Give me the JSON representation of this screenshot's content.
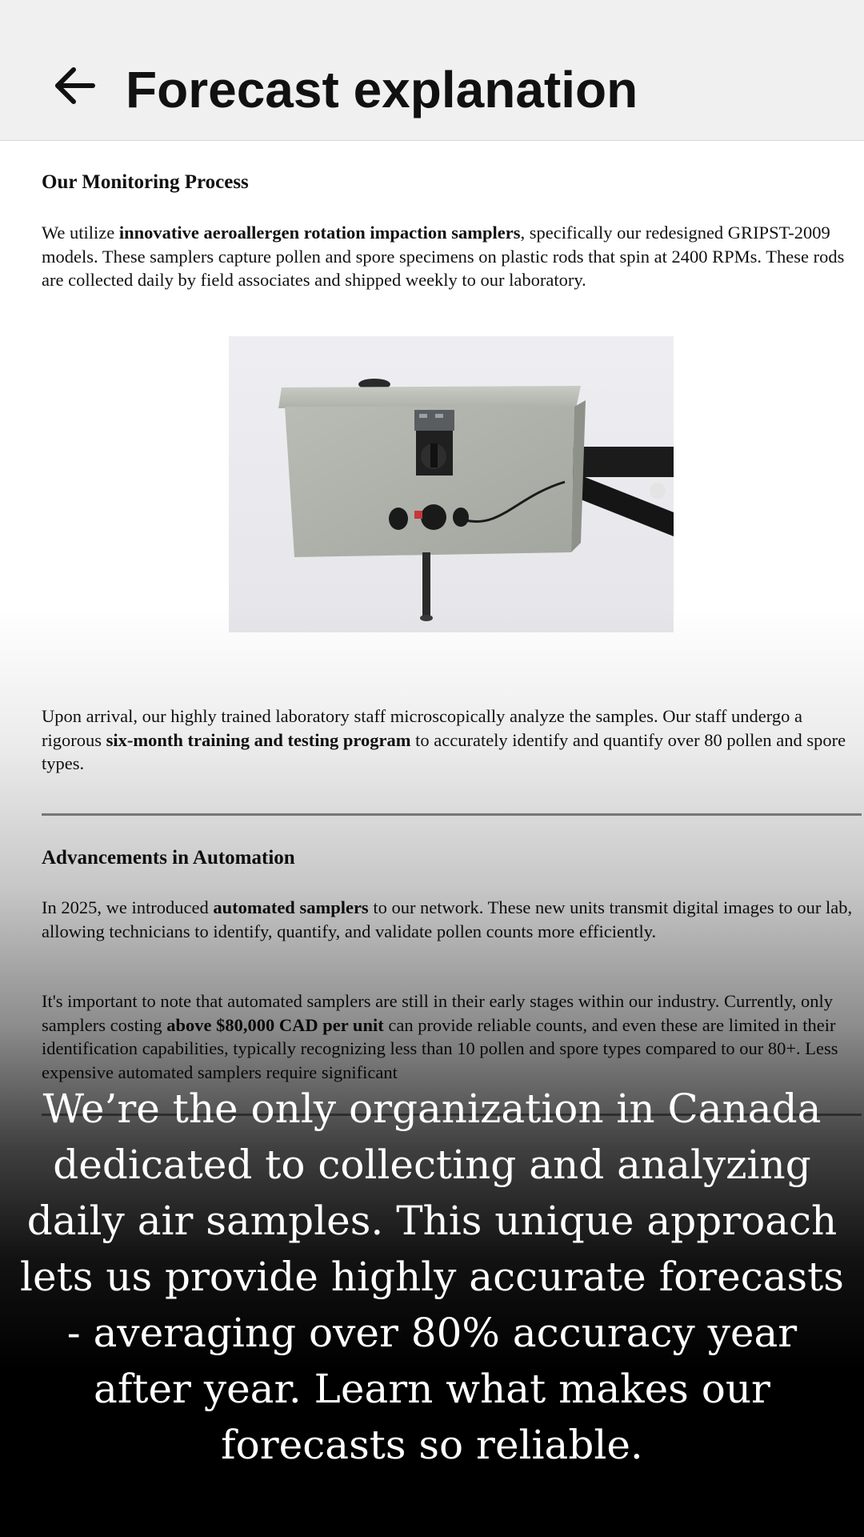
{
  "app_bar": {
    "back_icon": "arrow-left-icon",
    "title": "Forecast explanation"
  },
  "document": {
    "monitoring": {
      "heading": "Our Monitoring Process",
      "p1": {
        "pre": "We utilize ",
        "bold": "innovative aeroallergen rotation impaction samplers",
        "post": ", specifically our redesigned GRIPST-2009 models. These samplers capture pollen and spore specimens on plastic rods that spin at 2400 RPMs. These rods are collected daily by field associates and shipped weekly to our laboratory."
      },
      "p2": {
        "pre": "Upon arrival, our highly trained laboratory staff microscopically analyze the samples. Our staff undergo a rigorous ",
        "bold": "six-month training and testing program",
        "post": " to accurately identify and quantify over 80 pollen and spore types."
      }
    },
    "automation": {
      "heading": "Advancements in Automation",
      "p1": {
        "pre": "In 2025, we introduced ",
        "bold": "automated samplers",
        "post": " to our network. These new units transmit digital images to our lab, allowing technicians to identify, quantify, and validate pollen counts more efficiently."
      },
      "p2": {
        "pre": "It's important to note that automated samplers are still in their early stages within our industry. Currently, only samplers costing ",
        "bold": "above $80,000 CAD per unit",
        "post": " can provide reliable counts, and even these are limited in their identification capabilities, typically recognizing less than 10 pollen and spore types compared to our 80+. Less expensive automated samplers require significant"
      }
    }
  },
  "caption": "We’re the only organization in Canada dedicated to collecting and analyzing daily air samples. This unique approach lets us provide highly accurate forecasts - averaging over 80% accuracy year after year. Learn what makes our forecasts so reliable.",
  "colors": {
    "app_bar_bg": "#f0f0f0",
    "text": "#111111",
    "divider": "#8a8a8a",
    "caption_text": "#ffffff",
    "scrim": "#000000"
  }
}
